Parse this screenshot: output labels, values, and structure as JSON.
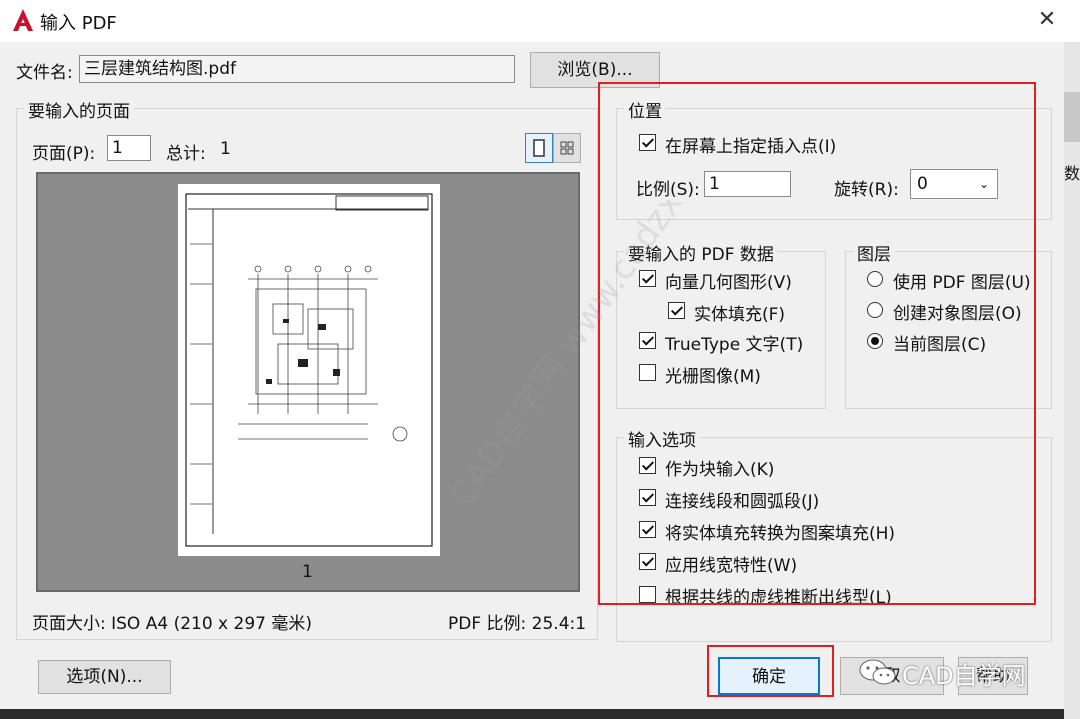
{
  "window": {
    "title": "输入 PDF",
    "close": "✕"
  },
  "file": {
    "label": "文件名:",
    "value": "三层建筑结构图.pdf",
    "browse_label": "浏览(B)..."
  },
  "pages": {
    "group_label": "要输入的页面",
    "page_label": "页面(P):",
    "page_value": "1",
    "total_label": "总计:",
    "total_value": "1",
    "thumb_caption": "1",
    "size_text": "页面大小: ISO A4 (210 x 297 毫米)",
    "scale_text": "PDF 比例: 25.4:1"
  },
  "position": {
    "group_label": "位置",
    "specify_on_screen": "在屏幕上指定插入点(I)",
    "scale_label": "比例(S):",
    "scale_value": "1",
    "rotation_label": "旋转(R):",
    "rotation_value": "0"
  },
  "pdf_data": {
    "group_label": "要输入的 PDF 数据",
    "items": [
      {
        "label": "向量几何图形(V)",
        "checked": true
      },
      {
        "label": "实体填充(F)",
        "checked": true
      },
      {
        "label": "TrueType 文字(T)",
        "checked": true
      },
      {
        "label": "光栅图像(M)",
        "checked": false
      }
    ]
  },
  "layers": {
    "group_label": "图层",
    "options": [
      {
        "label": "使用 PDF 图层(U)",
        "selected": false
      },
      {
        "label": "创建对象图层(O)",
        "selected": false
      },
      {
        "label": "当前图层(C)",
        "selected": true
      }
    ]
  },
  "import_options": {
    "group_label": "输入选项",
    "items": [
      {
        "label": "作为块输入(K)",
        "checked": true
      },
      {
        "label": "连接线段和圆弧段(J)",
        "checked": true
      },
      {
        "label": "将实体填充转换为图案填充(H)",
        "checked": true
      },
      {
        "label": "应用线宽特性(W)",
        "checked": true
      },
      {
        "label": "根据共线的虚线推断出线型(L)",
        "checked": false
      }
    ]
  },
  "footer": {
    "options_label": "选项(N)...",
    "ok_label": "确定",
    "cancel_label": "取",
    "help_label": "帮助"
  },
  "watermark": {
    "text": "CAD自学网",
    "diagonal": "CAD自学网 www.cadzxw.com"
  },
  "side": {
    "char": "数"
  },
  "colors": {
    "highlight": "#e02020",
    "preview_bg": "#8c8c8c"
  }
}
